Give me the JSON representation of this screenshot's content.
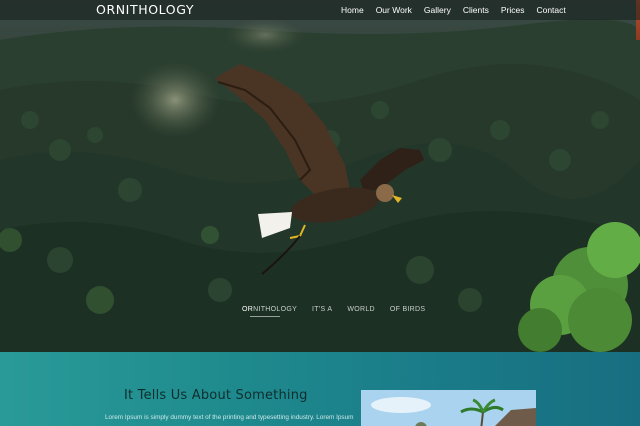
{
  "site": {
    "logo": "ORNITHOLOGY"
  },
  "nav": {
    "items": [
      {
        "label": "Home"
      },
      {
        "label": "Our Work"
      },
      {
        "label": "Gallery"
      },
      {
        "label": "Clients"
      },
      {
        "label": "Prices"
      },
      {
        "label": "Contact"
      }
    ]
  },
  "hero": {
    "image_icon": "eagle-flying-over-forest",
    "tabs": [
      {
        "accent": "OR",
        "rest": "NITHOLOGY"
      },
      {
        "accent": "",
        "rest": "IT'S A"
      },
      {
        "accent": "",
        "rest": "WORLD"
      },
      {
        "accent": "",
        "rest": "OF BIRDS"
      }
    ]
  },
  "about": {
    "heading": "It Tells Us About Something",
    "body": "Lorem Ipsum is simply dummy text of the printing and typesetting industry. Lorem Ipsum",
    "photo_icon": "palm-tree-photo"
  },
  "colors": {
    "teal_section": "#1f8b8e",
    "heading_text": "#0e2e2e",
    "nav_text": "#ffffff",
    "accent_edge": "#b8502c"
  }
}
